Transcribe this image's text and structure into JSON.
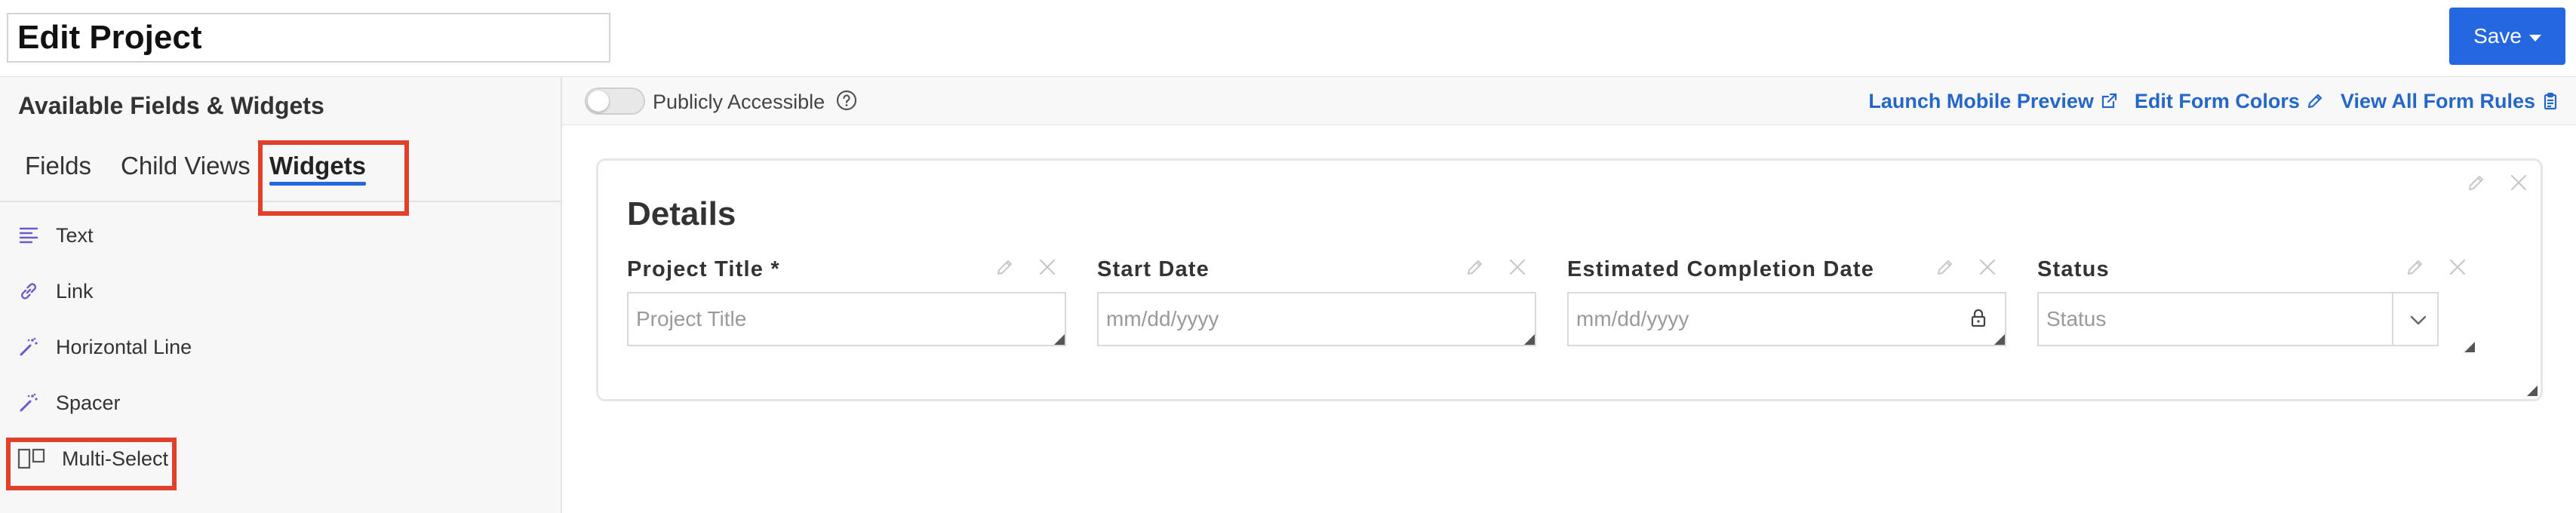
{
  "header": {
    "title_value": "Edit Project",
    "save_label": "Save"
  },
  "sidebar": {
    "title": "Available Fields & Widgets",
    "tabs": [
      {
        "label": "Fields",
        "active": false
      },
      {
        "label": "Child Views",
        "active": false
      },
      {
        "label": "Widgets",
        "active": true
      }
    ],
    "widgets": [
      {
        "label": "Text",
        "icon": "align-left-icon"
      },
      {
        "label": "Link",
        "icon": "link-icon"
      },
      {
        "label": "Horizontal Line",
        "icon": "magic-wand-icon"
      },
      {
        "label": "Spacer",
        "icon": "magic-wand-icon"
      },
      {
        "label": "Multi-Select",
        "icon": "columns-icon"
      }
    ]
  },
  "toolbar": {
    "public_label": "Publicly Accessible",
    "public_enabled": false,
    "links": [
      {
        "label": "Launch Mobile Preview",
        "icon": "external-link-icon"
      },
      {
        "label": "Edit Form Colors",
        "icon": "pencil-icon"
      },
      {
        "label": "View All Form Rules",
        "icon": "clipboard-icon"
      }
    ]
  },
  "form": {
    "section_title": "Details",
    "fields": [
      {
        "label": "Project Title *",
        "placeholder": "Project Title",
        "type": "text"
      },
      {
        "label": "Start Date",
        "placeholder": "mm/dd/yyyy",
        "type": "date"
      },
      {
        "label": "Estimated Completion Date",
        "placeholder": "mm/dd/yyyy",
        "type": "date-locked"
      },
      {
        "label": "Status",
        "placeholder": "Status",
        "type": "select"
      }
    ]
  },
  "colors": {
    "accent": "#2567e0",
    "link": "#2567c8",
    "highlight": "#e2402b",
    "widget_icon": "#6a5acd"
  }
}
